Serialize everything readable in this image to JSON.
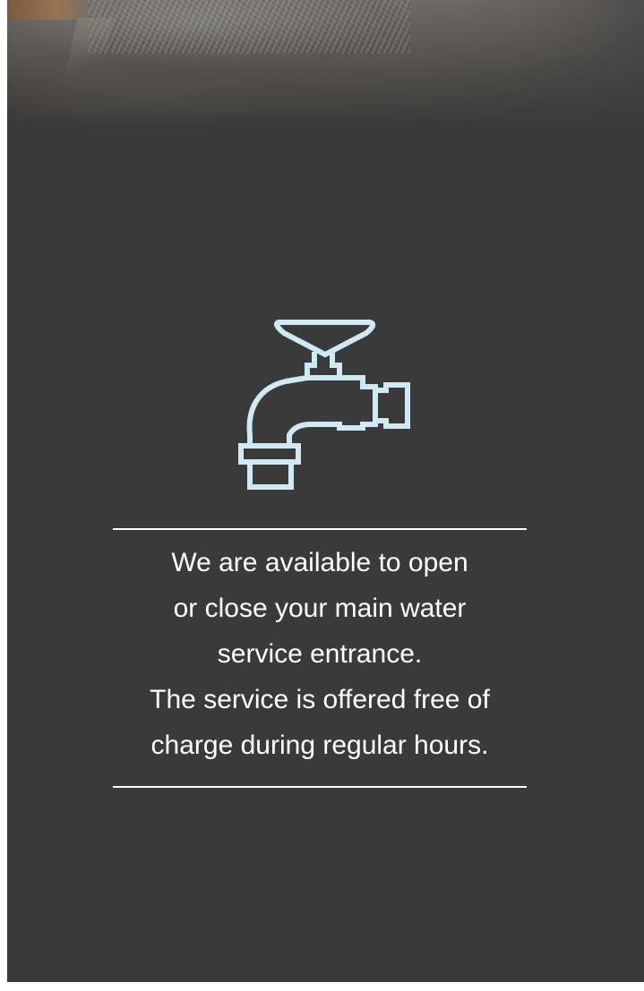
{
  "page": {
    "background_color": "#3a3a3a",
    "text_color": "#ffffff",
    "icon_color": "#cfe9f5"
  },
  "hero": {
    "icon": "faucet-icon"
  },
  "message": {
    "lines": [
      "We are available to open",
      "or close your main water",
      "service entrance.",
      "The service is offered free of",
      "charge during regular hours."
    ]
  }
}
